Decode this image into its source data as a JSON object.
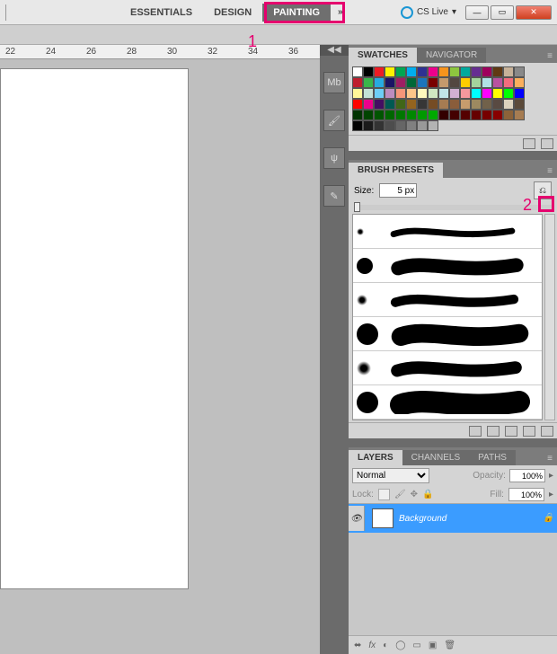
{
  "topbar": {
    "workspaces": [
      "ESSENTIALS",
      "DESIGN",
      "PAINTING"
    ],
    "active": 2,
    "more": "»",
    "cslive": "CS Live",
    "cslive_arrow": "▾"
  },
  "ruler_marks": [
    "22",
    "24",
    "26",
    "28",
    "30",
    "32",
    "34",
    "36"
  ],
  "dock_icons": [
    "Mb",
    "🖌",
    "ψ",
    "✎"
  ],
  "swatches": {
    "tab1": "SWATCHES",
    "tab2": "NAVIGATOR",
    "colors": [
      "#ffffff",
      "#000000",
      "#ed1c24",
      "#fff200",
      "#00a651",
      "#00aeef",
      "#2e3192",
      "#ec008c",
      "#f7941d",
      "#8dc63f",
      "#00a99d",
      "#662d91",
      "#9e005d",
      "#603913",
      "#c7b299",
      "#898989",
      "#be1e2d",
      "#39b54a",
      "#27aae1",
      "#1b1464",
      "#9e1f63",
      "#006837",
      "#1b75bc",
      "#790000",
      "#c49a6c",
      "#534741",
      "#ffcc00",
      "#a3d39c",
      "#b0e0e6",
      "#b9529f",
      "#f26d7d",
      "#fbaf5d",
      "#fff799",
      "#c2e2d6",
      "#6dcff6",
      "#bd8cbf",
      "#f69679",
      "#fdc689",
      "#fff9bd",
      "#d0e8c2",
      "#c1e6e9",
      "#d1b0d2",
      "#f5989d",
      "#00ffff",
      "#ff00ff",
      "#ffff00",
      "#00ff00",
      "#0000ff",
      "#ff0000",
      "#ec008c",
      "#440e62",
      "#005952",
      "#406618",
      "#94641f",
      "#363636",
      "#754c24",
      "#a67c52",
      "#8a5d3b",
      "#c69c6d",
      "#9d8960",
      "#71614a",
      "#594a42",
      "#dcd2bd",
      "#5b4a3a",
      "#003300",
      "#004400",
      "#005500",
      "#006600",
      "#007700",
      "#008800",
      "#009900",
      "#00aa00",
      "#330000",
      "#440000",
      "#550000",
      "#660000",
      "#770000",
      "#880000",
      "#8c6239",
      "#a67c52",
      "#000000",
      "#1a1a1a",
      "#333333",
      "#4d4d4d",
      "#666666",
      "#808080",
      "#999999",
      "#b3b3b3"
    ]
  },
  "brush": {
    "tab": "BRUSH PRESETS",
    "size_label": "Size:",
    "size_value": "5 px",
    "presets": [
      {
        "t": "soft",
        "w": 8
      },
      {
        "t": "hard",
        "w": 18
      },
      {
        "t": "soft",
        "w": 12
      },
      {
        "t": "hard",
        "w": 24
      },
      {
        "t": "soft",
        "w": 16
      },
      {
        "t": "hard",
        "w": 28
      }
    ]
  },
  "layers": {
    "tab1": "LAYERS",
    "tab2": "CHANNELS",
    "tab3": "PATHS",
    "mode": "Normal",
    "opacity_label": "Opacity:",
    "opacity_value": "100%",
    "lock_label": "Lock:",
    "fill_label": "Fill:",
    "fill_value": "100%",
    "bg": "Background"
  },
  "annotations": {
    "a1": "1",
    "a2": "2"
  }
}
